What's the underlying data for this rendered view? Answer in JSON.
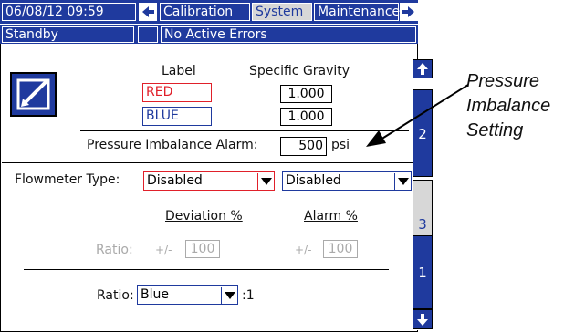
{
  "topbar": {
    "datetime": "06/08/12 09:59",
    "tabs": [
      "Calibration",
      "System",
      "Maintenance"
    ],
    "selected_tab": "System"
  },
  "statusbar": {
    "mode": "Standby",
    "errors": "No Active Errors"
  },
  "content": {
    "label_header": "Label",
    "sg_header": "Specific Gravity",
    "label_red": "RED",
    "label_blue": "BLUE",
    "sg_red": "1.000",
    "sg_blue": "1.000",
    "pressure_label": "Pressure Imbalance Alarm:",
    "pressure_value": "500",
    "pressure_unit": "psi",
    "flowmeter_label": "Flowmeter Type:",
    "flowmeter_red": "Disabled",
    "flowmeter_blue": "Disabled",
    "deviation_header": "Deviation %",
    "alarm_header": "Alarm %",
    "ratio_label": "Ratio:",
    "plusminus": "+/-",
    "deviation_value": "100",
    "alarm_value": "100",
    "ratio_select": "Blue",
    "ratio_suffix": ":1"
  },
  "side_tabs": [
    "2",
    "3",
    "1"
  ],
  "selected_side_tab": "3",
  "callout": {
    "line1": "Pressure",
    "line2": "Imbalance",
    "line3": "Setting"
  },
  "colors": {
    "primary_blue": "#1f3a9e",
    "red_field": "#e0202a",
    "blue_field": "#1f3a9e",
    "selected_gray": "#d7d7d7"
  }
}
